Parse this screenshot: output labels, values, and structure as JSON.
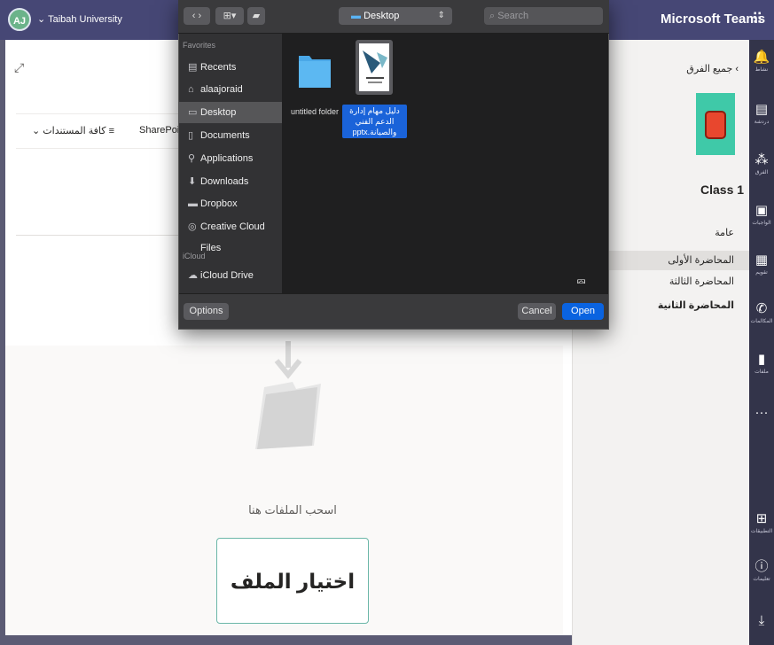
{
  "topbar": {
    "org_initials": "AJ",
    "org_name": "Taibah University",
    "org_chevron": "⌄",
    "app_title": "Microsoft Teams",
    "apps_icon": "grid-icon"
  },
  "rail": {
    "items": [
      {
        "icon": "bell-icon",
        "glyph": "🔔",
        "label": "نشاط"
      },
      {
        "icon": "chat-icon",
        "glyph": "▤",
        "label": "دردشة"
      },
      {
        "icon": "teams-icon",
        "glyph": "⁂",
        "label": "الفرق"
      },
      {
        "icon": "assignments-icon",
        "glyph": "▣",
        "label": "الواجبات"
      },
      {
        "icon": "calendar-icon",
        "glyph": "▦",
        "label": "تقويم"
      },
      {
        "icon": "calls-icon",
        "glyph": "✆",
        "label": "المكالمات"
      },
      {
        "icon": "files-icon",
        "glyph": "▮",
        "label": "ملفات"
      },
      {
        "icon": "more-icon",
        "glyph": "···",
        "label": ""
      },
      {
        "icon": "apps-icon",
        "glyph": "⊞",
        "label": "التطبيقات"
      },
      {
        "icon": "help-icon",
        "glyph": "?",
        "label": "تعليمات"
      },
      {
        "icon": "download-icon",
        "glyph": "⤓",
        "label": ""
      }
    ]
  },
  "teams_panel": {
    "all_teams": "جميع الفرق",
    "back_chevron": "‹",
    "class_name": "Class 1",
    "channels": [
      "عامة",
      "المحاضرة الأولى",
      "المحاضرة الثالثة",
      "المحاضرة الثانية"
    ]
  },
  "main": {
    "expand_icon": "expand-icon",
    "all_docs": "كافة المستندات",
    "filter_chevron": "⌄",
    "filter_glyph": "≡",
    "sharepoint": "SharePoint",
    "drag_text": "اسحب الملفات هنا",
    "choose_file": "اختيار الملف"
  },
  "dialog": {
    "location": "Desktop",
    "search_placeholder": "Search",
    "sidebar_headers": {
      "favorites": "Favorites",
      "icloud": "iCloud"
    },
    "favorites": [
      {
        "label": "Recents",
        "icon": "recents-icon",
        "glyph": "▤"
      },
      {
        "label": "alaajoraid",
        "icon": "home-icon",
        "glyph": "⌂"
      },
      {
        "label": "Desktop",
        "icon": "desktop-icon",
        "glyph": "▭"
      },
      {
        "label": "Documents",
        "icon": "documents-icon",
        "glyph": "▯"
      },
      {
        "label": "Applications",
        "icon": "applications-icon",
        "glyph": "⚲"
      },
      {
        "label": "Downloads",
        "icon": "downloads-icon",
        "glyph": "⬇"
      },
      {
        "label": "Dropbox",
        "icon": "dropbox-icon",
        "glyph": "▬"
      },
      {
        "label": "Creative Cloud Files",
        "icon": "creative-cloud-icon",
        "glyph": "◎"
      }
    ],
    "icloud": [
      {
        "label": "iCloud Drive",
        "icon": "cloud-icon",
        "glyph": "☁"
      }
    ],
    "files": [
      {
        "label": "untitled folder",
        "type": "folder"
      },
      {
        "label": "دليل مهام إدارة الدعم الفني والصيانة.pptx",
        "type": "pptx"
      }
    ],
    "options": "Options",
    "cancel": "Cancel",
    "open": "Open"
  }
}
